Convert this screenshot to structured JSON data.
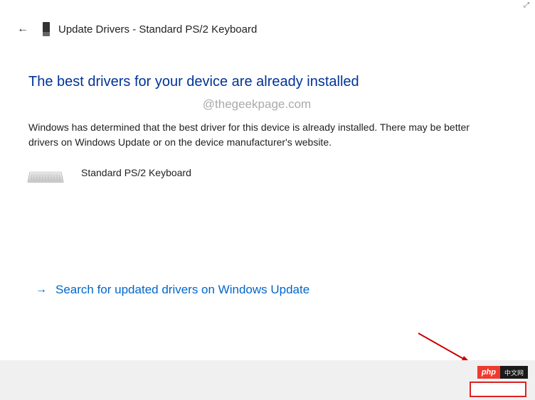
{
  "header": {
    "title": "Update Drivers - Standard PS/2 Keyboard"
  },
  "main": {
    "heading": "The best drivers for your device are already installed",
    "watermark": "@thegeekpage.com",
    "description": "Windows has determined that the best driver for this device is already installed. There may be better drivers on Windows Update or on the device manufacturer's website.",
    "device_name": "Standard PS/2 Keyboard"
  },
  "link": {
    "text": "Search for updated drivers on Windows Update"
  },
  "badge": {
    "left": "php",
    "right": "中文网"
  }
}
